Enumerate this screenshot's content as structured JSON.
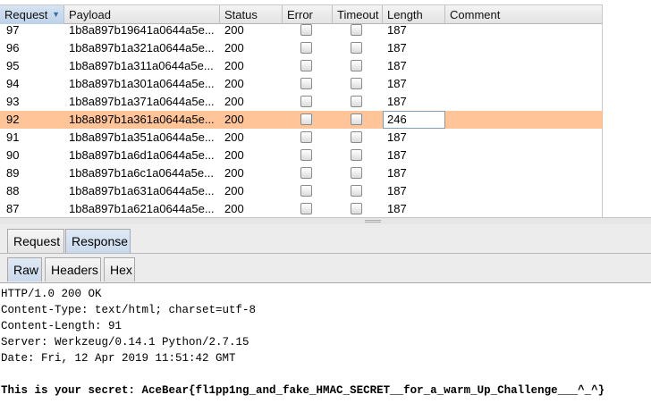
{
  "table": {
    "columns": [
      "Request",
      "Payload",
      "Status",
      "Error",
      "Timeout",
      "Length",
      "Comment"
    ],
    "sort_indicator": "▼",
    "rows": [
      {
        "request": "97",
        "payload": "1b8a897b19641a0644a5e...",
        "status": "200",
        "error": false,
        "timeout": false,
        "length": "187",
        "comment": "",
        "selected": false
      },
      {
        "request": "96",
        "payload": "1b8a897b1a321a0644a5e...",
        "status": "200",
        "error": false,
        "timeout": false,
        "length": "187",
        "comment": "",
        "selected": false
      },
      {
        "request": "95",
        "payload": "1b8a897b1a311a0644a5e...",
        "status": "200",
        "error": false,
        "timeout": false,
        "length": "187",
        "comment": "",
        "selected": false
      },
      {
        "request": "94",
        "payload": "1b8a897b1a301a0644a5e...",
        "status": "200",
        "error": false,
        "timeout": false,
        "length": "187",
        "comment": "",
        "selected": false
      },
      {
        "request": "93",
        "payload": "1b8a897b1a371a0644a5e...",
        "status": "200",
        "error": false,
        "timeout": false,
        "length": "187",
        "comment": "",
        "selected": false
      },
      {
        "request": "92",
        "payload": "1b8a897b1a361a0644a5e...",
        "status": "200",
        "error": false,
        "timeout": false,
        "length": "246",
        "comment": "",
        "selected": true
      },
      {
        "request": "91",
        "payload": "1b8a897b1a351a0644a5e...",
        "status": "200",
        "error": false,
        "timeout": false,
        "length": "187",
        "comment": "",
        "selected": false
      },
      {
        "request": "90",
        "payload": "1b8a897b1a6d1a0644a5e...",
        "status": "200",
        "error": false,
        "timeout": false,
        "length": "187",
        "comment": "",
        "selected": false
      },
      {
        "request": "89",
        "payload": "1b8a897b1a6c1a0644a5e...",
        "status": "200",
        "error": false,
        "timeout": false,
        "length": "187",
        "comment": "",
        "selected": false
      },
      {
        "request": "88",
        "payload": "1b8a897b1a631a0644a5e...",
        "status": "200",
        "error": false,
        "timeout": false,
        "length": "187",
        "comment": "",
        "selected": false
      },
      {
        "request": "87",
        "payload": "1b8a897b1a621a0644a5e...",
        "status": "200",
        "error": false,
        "timeout": false,
        "length": "187",
        "comment": "",
        "selected": false
      }
    ]
  },
  "tabs": {
    "main": [
      "Request",
      "Response"
    ],
    "main_active": "Response",
    "sub": [
      "Raw",
      "Headers",
      "Hex"
    ],
    "sub_active": "Raw"
  },
  "response": {
    "lines": [
      "HTTP/1.0 200 OK",
      "Content-Type: text/html; charset=utf-8",
      "Content-Length: 91",
      "Server: Werkzeug/0.14.1 Python/2.7.15",
      "Date: Fri, 12 Apr 2019 11:51:42 GMT",
      "",
      "This is your secret: AceBear{fl1pp1ng_and_fake_HMAC_SECRET__for_a_warm_Up_Challenge___^_^}"
    ]
  },
  "colors": {
    "selected_row": "#ffc599",
    "active_tab": "#c9d9ec",
    "header_bg": "#e3e3e3"
  }
}
